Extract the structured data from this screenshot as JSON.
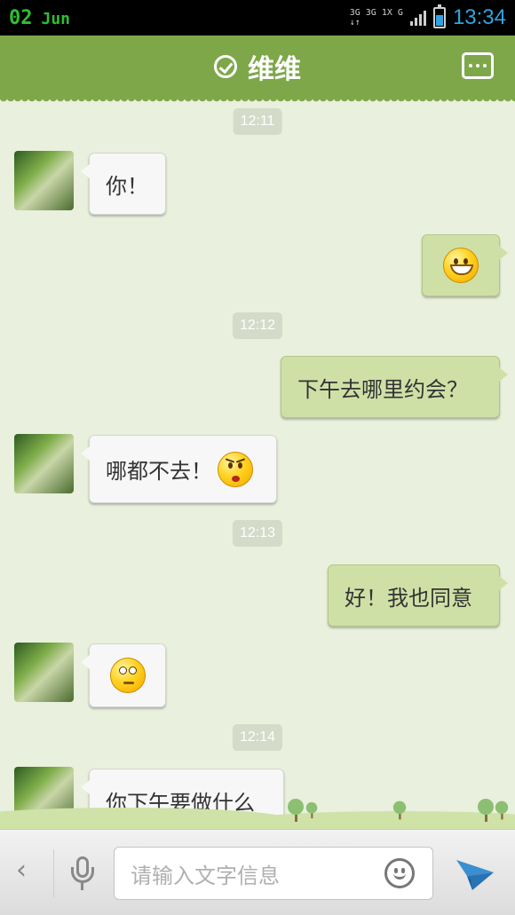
{
  "status_bar": {
    "day": "02",
    "month": "Jun",
    "network_line1": "3G 3G 1X G",
    "network_line2": "↓↑",
    "time": "13:34"
  },
  "header": {
    "title": "维维",
    "verified_icon": "check-circle-icon",
    "more_icon": "more-dots-icon"
  },
  "messages": [
    {
      "type": "timestamp",
      "text": "12:11"
    },
    {
      "type": "incoming",
      "text": "你！"
    },
    {
      "type": "outgoing",
      "emoji": "grin-emoji"
    },
    {
      "type": "timestamp",
      "text": "12:12"
    },
    {
      "type": "outgoing",
      "text": "下午去哪里约会？"
    },
    {
      "type": "incoming",
      "text": "哪都不去！",
      "emoji": "angry-emoji"
    },
    {
      "type": "timestamp",
      "text": "12:13"
    },
    {
      "type": "outgoing",
      "text": "好！我也同意"
    },
    {
      "type": "incoming",
      "emoji": "eyeroll-emoji"
    },
    {
      "type": "timestamp",
      "text": "12:14"
    },
    {
      "type": "incoming",
      "text": "你下午要做什么"
    }
  ],
  "input_bar": {
    "back_glyph": "‹",
    "placeholder": "请输入文字信息",
    "icons": [
      "chevron-left-icon",
      "microphone-icon",
      "smiley-icon",
      "send-icon"
    ]
  },
  "colors": {
    "header": "#7ea74a",
    "background": "#e9f0dd",
    "outgoing_bubble": "#cfe0a6",
    "incoming_bubble": "#f7f7f7",
    "time_accent": "#31a3e0"
  }
}
